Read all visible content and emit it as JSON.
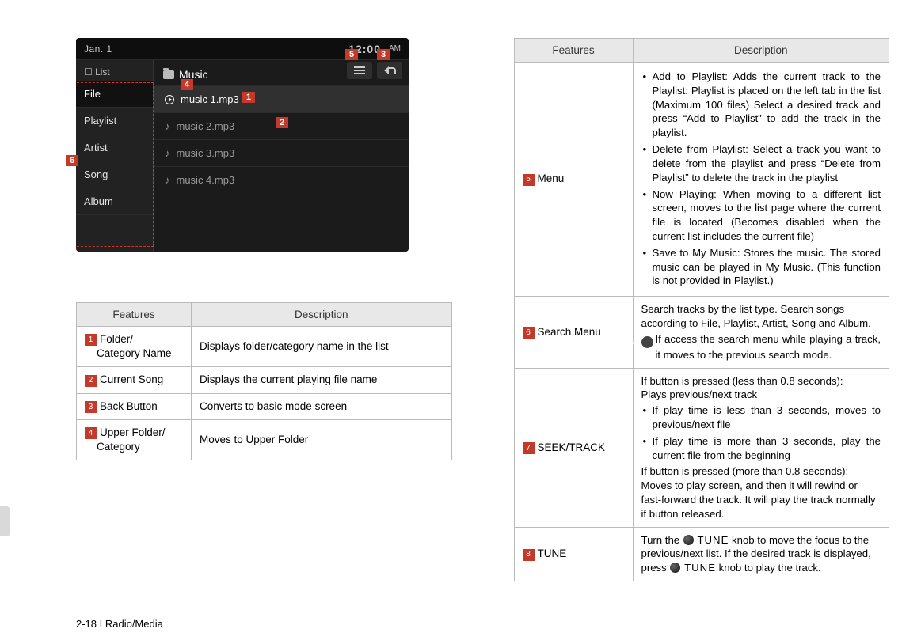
{
  "device": {
    "date": "Jan. 1",
    "time": "12:00",
    "ampm": "AM",
    "sidebar_label": "List",
    "sidebar_items": [
      "File",
      "Playlist",
      "Artist",
      "Song",
      "Album"
    ],
    "content_title": "Music",
    "tracks": [
      "music 1.mp3",
      "music 2.mp3",
      "music 3.mp3",
      "music 4.mp3"
    ]
  },
  "callout_labels": {
    "n1": "1",
    "n2": "2",
    "n3": "3",
    "n4": "4",
    "n5": "5",
    "n6": "6",
    "n7": "7",
    "n8": "8"
  },
  "left_table": {
    "headers": {
      "features": "Features",
      "description": "Description"
    },
    "rows": [
      {
        "num": "1",
        "label": "Folder/\nCategory Name",
        "desc": "Displays folder/category name in the list"
      },
      {
        "num": "2",
        "label": "Current Song",
        "desc": "Displays the current playing file name"
      },
      {
        "num": "3",
        "label": "Back Button",
        "desc": "Converts to basic mode screen"
      },
      {
        "num": "4",
        "label": "Upper Folder/\nCategory",
        "desc": "Moves to Upper Folder"
      }
    ]
  },
  "right_table": {
    "headers": {
      "features": "Features",
      "description": "Description"
    },
    "rows": {
      "menu": {
        "num": "5",
        "label": "Menu",
        "bullets": [
          "Add to Playlist: Adds the current track to the Playlist: Playlist is placed on the left tab in the list (Maximum 100 files) Select a desired track and press “Add to Playlist” to add the track in the playlist.",
          "Delete from Playlist: Select a track you want to delete from the playlist and press “Delete from Playlist” to delete the track in the playlist",
          "Now Playing: When moving to a different list screen, moves to the list page where the current file is located (Becomes disabled when the current list includes the current file)",
          "Save to My Music: Stores the music. The stored music can be played in My Music. (This function is not provided in Playlist.)"
        ]
      },
      "search": {
        "num": "6",
        "label": "Search Menu",
        "line1": "Search tracks by the list type. Search songs according to File, Playlist, Artist, Song and Album.",
        "info": "If access the search menu while playing a track, it moves to the previous search mode."
      },
      "seek": {
        "num": "7",
        "label": "SEEK/TRACK",
        "pre": "If button is pressed (less than 0.8 seconds):\nPlays previous/next track",
        "bullets": [
          "If play time is less than 3 seconds, moves to previous/next file",
          "If play time is more than 3 seconds, play the current file from the beginning"
        ],
        "post": "If button is pressed (more than 0.8 seconds):\nMoves to play screen, and then it will rewind or fast-forward the track. It will play the track normally if button released."
      },
      "tune": {
        "num": "8",
        "label": "TUNE",
        "part1": "Turn the ",
        "knob1_label": "TUNE",
        "part2": " knob to move the focus to the previous/next list. If the desired track is displayed, press ",
        "knob2_label": "TUNE",
        "part3": " knob to play the track."
      }
    }
  },
  "footer": "2-18 I Radio/Media"
}
